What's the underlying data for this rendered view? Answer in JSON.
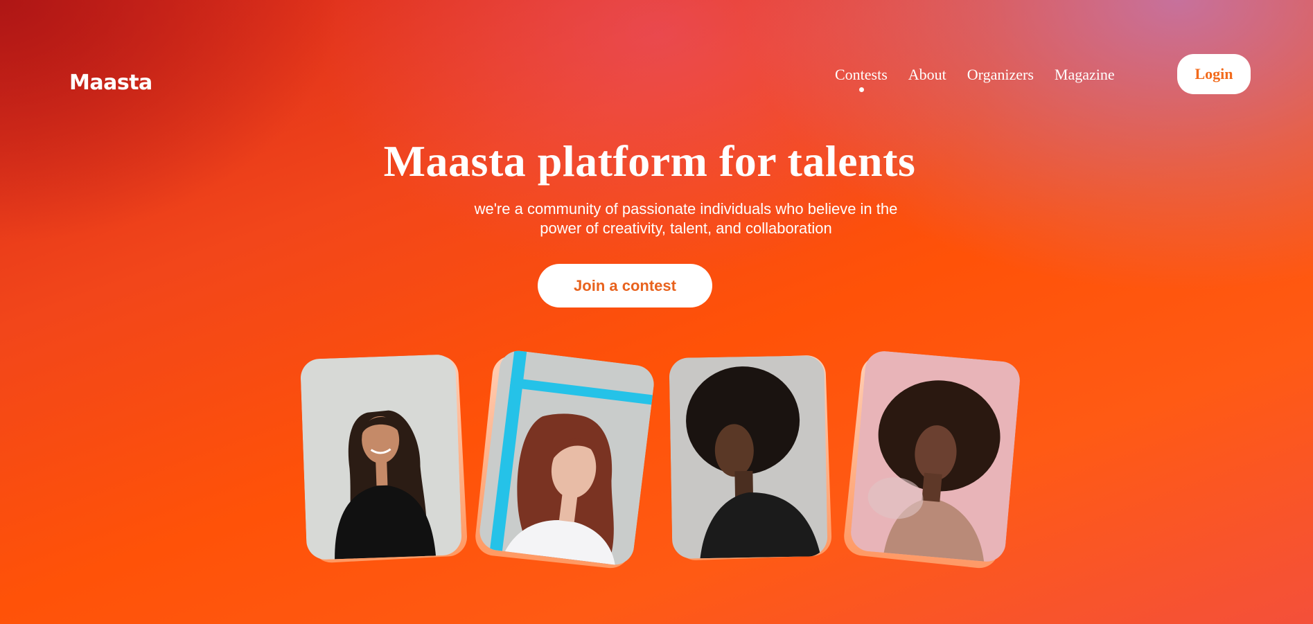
{
  "brand": {
    "name": "Maasta"
  },
  "nav": {
    "items": [
      {
        "label": "Contests",
        "active": true
      },
      {
        "label": "About",
        "active": false
      },
      {
        "label": "Organizers",
        "active": false
      },
      {
        "label": "Magazine",
        "active": false
      }
    ],
    "login_label": "Login"
  },
  "hero": {
    "title": "Maasta platform for talents",
    "subtitle_line1": "we're a community of passionate individuals who believe in the",
    "subtitle_line2": "power of creativity, talent, and collaboration",
    "cta_label": "Join a contest"
  },
  "colors": {
    "accent": "#f26a1b",
    "background_start": "#d8281c",
    "background_mid": "#ff5208",
    "background_top_right": "#be78b4",
    "white": "#ffffff"
  },
  "gallery": {
    "cards": [
      {
        "subject": "woman-long-dark-hair-black-top-smiling",
        "bg": "#d7d9d6"
      },
      {
        "subject": "woman-auburn-hair-white-top-blue-frame",
        "bg": "#c9cccb"
      },
      {
        "subject": "woman-afro-black-jacket",
        "bg": "#c8c7c5"
      },
      {
        "subject": "woman-afro-bare-shoulders-pink-bg",
        "bg": "#e8b4b8"
      }
    ]
  }
}
